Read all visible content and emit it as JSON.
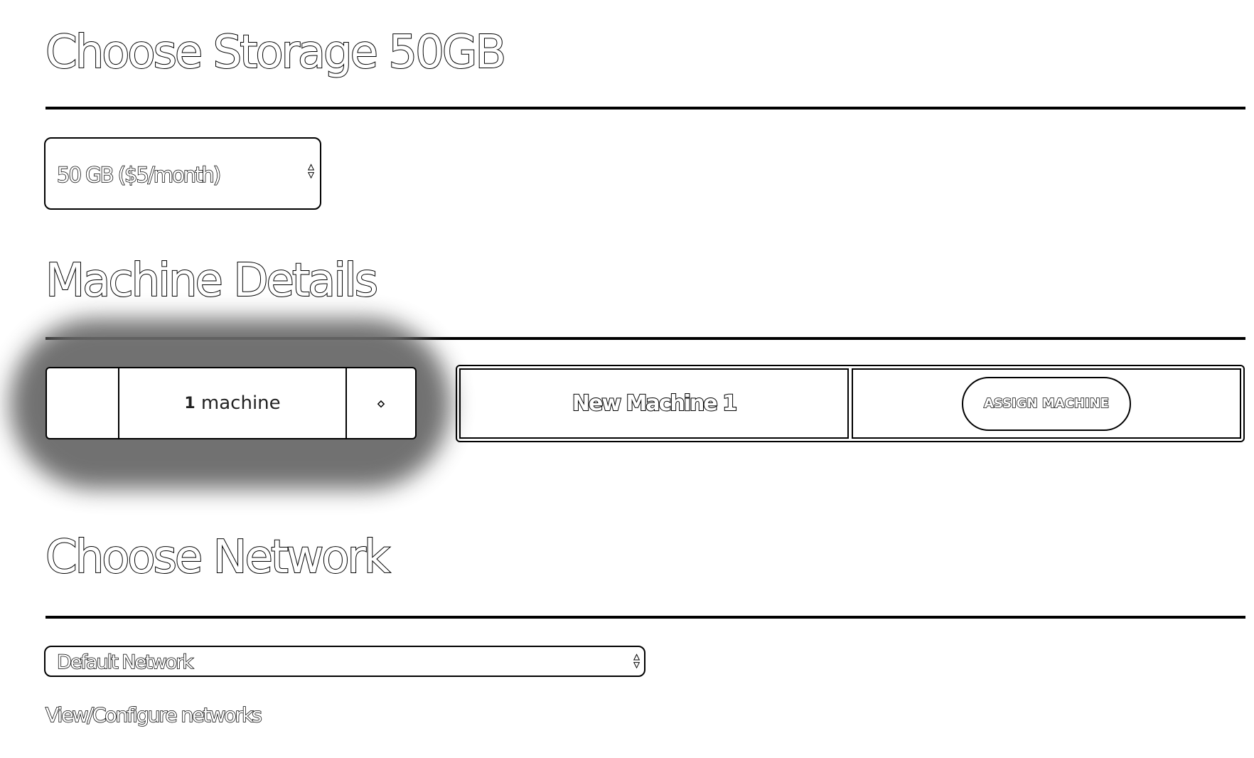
{
  "storage": {
    "heading": "Choose Storage 50GB",
    "selected_option": "50 GB ($5/month)"
  },
  "machine_details": {
    "heading": "Machine Details",
    "count_value": "1",
    "count_unit": "machine",
    "machines": [
      {
        "name": "New Machine 1",
        "action_label": "ASSIGN MACHINE"
      }
    ]
  },
  "network": {
    "heading": "Choose Network",
    "selected_option": "Default Network",
    "configure_link": "View/Configure networks"
  }
}
